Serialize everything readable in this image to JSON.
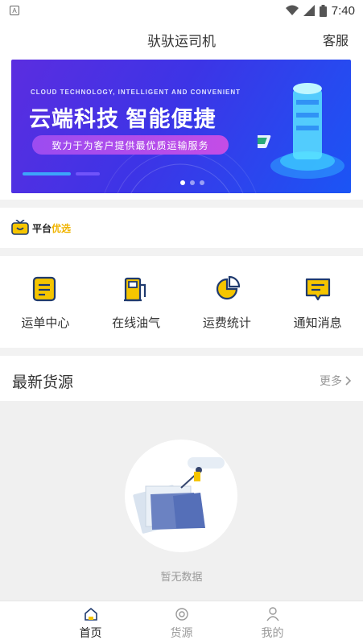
{
  "status_bar": {
    "time": "7:40",
    "left_badge": "A"
  },
  "header": {
    "title": "驮驮运司机",
    "right": "客服"
  },
  "banner": {
    "subtitle": "CLOUD TECHNOLOGY, INTELLIGENT AND CONVENIENT",
    "title": "云端科技  智能便捷",
    "pill": "致力于为客户提供最优质运输服务",
    "dots": 3,
    "active_dot": 0
  },
  "platform_pick": {
    "label_a": "平台",
    "label_b": "优选"
  },
  "quick_menu": [
    {
      "label": "运单中心",
      "icon": "document-icon"
    },
    {
      "label": "在线油气",
      "icon": "fuel-pump-icon"
    },
    {
      "label": "运费统计",
      "icon": "pie-chart-icon"
    },
    {
      "label": "通知消息",
      "icon": "message-icon"
    }
  ],
  "newest": {
    "title": "最新货源",
    "more": "更多"
  },
  "empty": {
    "text": "暂无数据"
  },
  "tabbar": [
    {
      "label": "首页",
      "icon": "home-icon",
      "active": true
    },
    {
      "label": "货源",
      "icon": "cargo-icon",
      "active": false
    },
    {
      "label": "我的",
      "icon": "user-icon",
      "active": false
    }
  ],
  "colors": {
    "accent_yellow": "#f5c500",
    "icon_navy": "#1f3a6e",
    "banner_purple": "#4a30e8"
  }
}
